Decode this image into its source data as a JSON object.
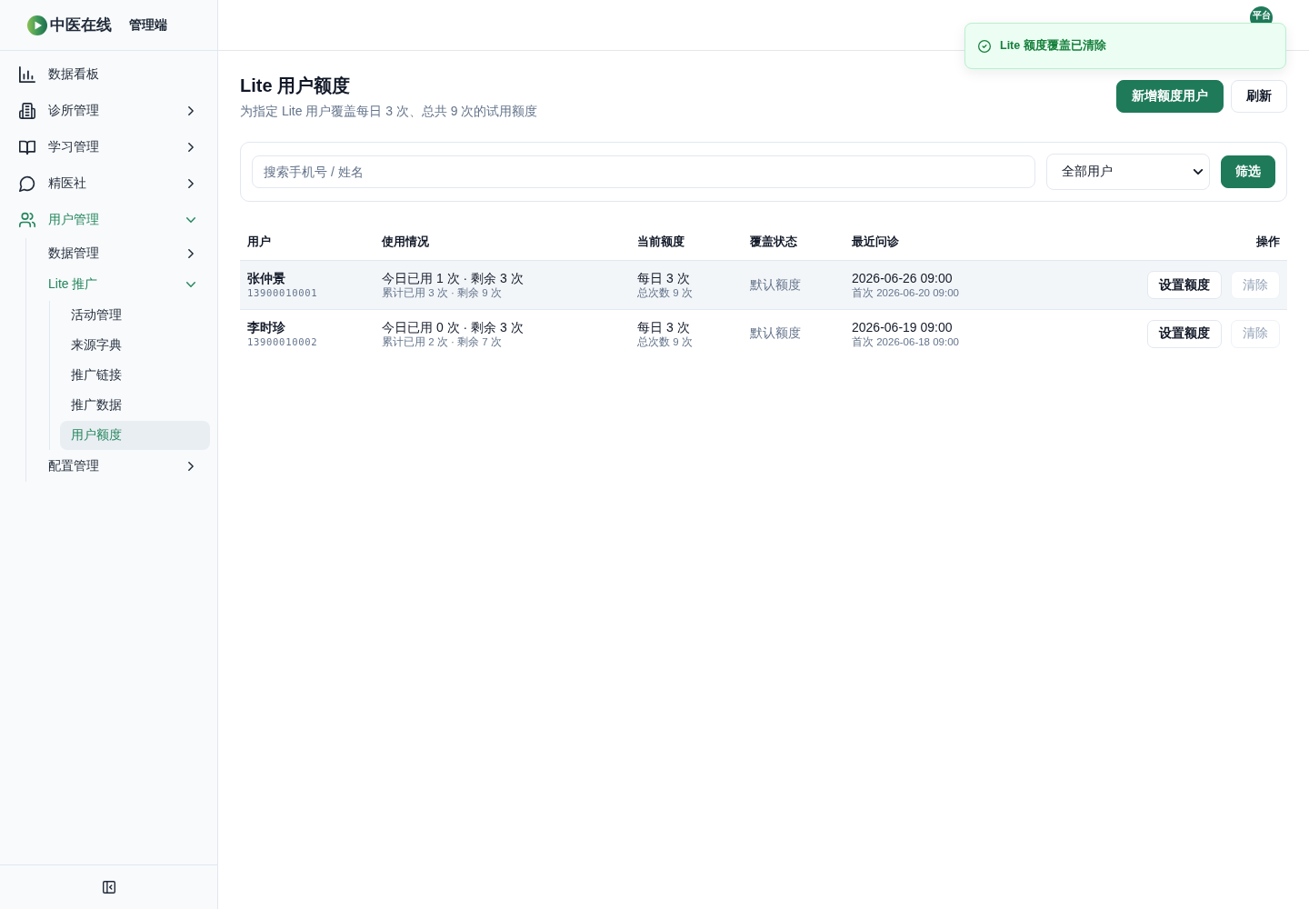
{
  "sidebar": {
    "brand": {
      "name": "中医在线",
      "subtitle": "管理端"
    },
    "items": [
      {
        "label": "数据看板",
        "selected": false
      },
      {
        "label": "诊所管理",
        "selected": false,
        "expanded": false
      },
      {
        "label": "学习管理",
        "selected": false,
        "expanded": false
      },
      {
        "label": "精医社",
        "selected": false,
        "expanded": false
      },
      {
        "label": "用户管理",
        "selected": false,
        "expanded": true,
        "children": [
          {
            "label": "数据管理",
            "selected": false,
            "expanded": false
          },
          {
            "label": "Lite 推广",
            "selected": false,
            "expanded": true,
            "children": [
              {
                "label": "活动管理",
                "selected": false
              },
              {
                "label": "来源字典",
                "selected": false
              },
              {
                "label": "推广链接",
                "selected": false
              },
              {
                "label": "推广数据",
                "selected": false
              },
              {
                "label": "用户额度",
                "selected": true
              }
            ]
          },
          {
            "label": "配置管理",
            "selected": false,
            "expanded": false
          }
        ]
      }
    ]
  },
  "top_bar": {
    "avatar": "平台"
  },
  "toast": {
    "kind": "success",
    "message": "Lite 额度覆盖已清除"
  },
  "page": {
    "title": "Lite 用户额度",
    "subtitle": "为指定 Lite 用户覆盖每日 3 次、总共 9 次的试用额度",
    "buttons": [
      {
        "label": "新增额度用户",
        "kind": "primary"
      },
      {
        "label": "刷新",
        "kind": "default"
      }
    ]
  },
  "filter": {
    "search": {
      "placeholder": "搜索手机号 / 姓名"
    },
    "select": {
      "value": "全部用户"
    },
    "button": {
      "label": "筛选",
      "kind": "primary"
    }
  },
  "table": {
    "columns": [
      "用户",
      "使用情况",
      "当前额度",
      "覆盖状态",
      "最近问诊",
      "操作"
    ],
    "rows": [
      {
        "highlighted": true,
        "user": {
          "name": "张仲景",
          "phone": "13900010001"
        },
        "usage": {
          "today": "今日已用 1 次 · 剩余 3 次",
          "total": "累计已用 3 次 · 剩余 9 次"
        },
        "quota": {
          "daily": "每日 3 次",
          "total": "总次数 9 次"
        },
        "override_status": "默认额度",
        "last_visit": {
          "latest": "2026-06-26 09:00",
          "first": "首次 2026-06-20 09:00"
        },
        "actions": [
          {
            "label": "设置额度",
            "disabled": false
          },
          {
            "label": "清除",
            "disabled": true
          }
        ]
      },
      {
        "highlighted": false,
        "user": {
          "name": "李时珍",
          "phone": "13900010002"
        },
        "usage": {
          "today": "今日已用 0 次 · 剩余 3 次",
          "total": "累计已用 2 次 · 剩余 7 次"
        },
        "quota": {
          "daily": "每日 3 次",
          "total": "总次数 9 次"
        },
        "override_status": "默认额度",
        "last_visit": {
          "latest": "2026-06-19 09:00",
          "first": "首次 2026-06-18 09:00"
        },
        "actions": [
          {
            "label": "设置额度",
            "disabled": false
          },
          {
            "label": "清除",
            "disabled": true
          }
        ]
      }
    ]
  }
}
